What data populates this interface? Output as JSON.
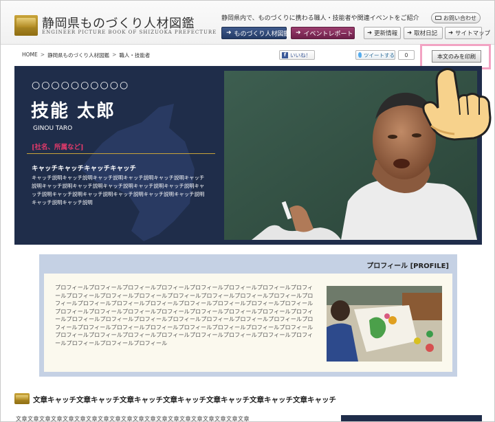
{
  "header": {
    "site_title": "静岡県ものづくり人材図鑑",
    "site_subtitle": "ENGINEER PICTURE BOOK OF SHIZUOKA PREFECTURE",
    "tagline": "静岡県内で、ものづくりに携わる職人・技能者や関連イベントをご紹介",
    "contact_label": "お問い合わせ",
    "nav": {
      "zukan": "ものづくり人材図鑑",
      "event": "イベントレポート",
      "update": "更新情報",
      "report": "取材日記",
      "sitemap": "サイトマップ"
    }
  },
  "breadcrumb": {
    "home": "HOME",
    "zukan": "静岡県ものづくり人材図鑑",
    "current": "職人・技能者"
  },
  "social": {
    "like_label": "いいね！",
    "tweet_label": "ツイートする",
    "tweet_count": "0"
  },
  "print_label": "本文のみを印刷",
  "hero": {
    "code": "○○○○○○○○○○",
    "name": "技能 太郎",
    "roman": "GINOU TARO",
    "company": "[社名、所属など]",
    "catch": "キャッチキャッチキャッチキャッチ",
    "description": "キャッチ説明キャッチ説明キャッチ説明キャッチ説明キャッチ説明キャッチ説明キャッチ説明キャッチ説明キャッチ説明キャッチ説明キャッチ説明キャッチ説明キャッチ説明キャッチ説明キャッチ説明キャッチ説明キャッチ説明キャッチ説明キャッチ説明"
  },
  "profile": {
    "title": "プロフィール [PROFILE]",
    "text": "プロフィールプロフィールプロフィールプロフィールプロフィールプロフィールプロフィールプロフィールプロフィールプロフィールプロフィールプロフィールプロフィールプロフィールプロフィールプロフィールプロフィールプロフィールプロフィールプロフィールプロフィールプロフィールプロフィールプロフィールプロフィールプロフィールプロフィールプロフィールプロフィールプロフィールプロフィールプロフィールプロフィールプロフィールプロフィールプロフィールプロフィールプロフィールプロフィールプロフィールプロフィールプロフィールプロフィールプロフィールプロフィールプロフィールプロフィールプロフィールプロフィールプロフィールプロフィールプロフィールプロフィールプロフィールプロフィールプロフィールプロフィール"
  },
  "section": {
    "title": "文章キャッチ文章キャッチ文章キャッチ文章キャッチ文章キャッチ文章キャッチ文章キャッチ",
    "text": "文章文章文章文章文章文章文章文章文章文章文章文章文章文章文章文章文章文章文章文章"
  },
  "colors": {
    "accent_navy": "#1f2d4a",
    "event_magenta": "#7d2553",
    "company_pink": "#e23a6b",
    "highlight_pink": "#f2a3c3",
    "profile_blue": "#c5d1e4"
  },
  "icons": [
    "logo-emblem-icon",
    "arrow-right-icon",
    "mail-icon",
    "facebook-icon",
    "twitter-icon",
    "pointing-hand-icon",
    "section-emblem-icon"
  ]
}
